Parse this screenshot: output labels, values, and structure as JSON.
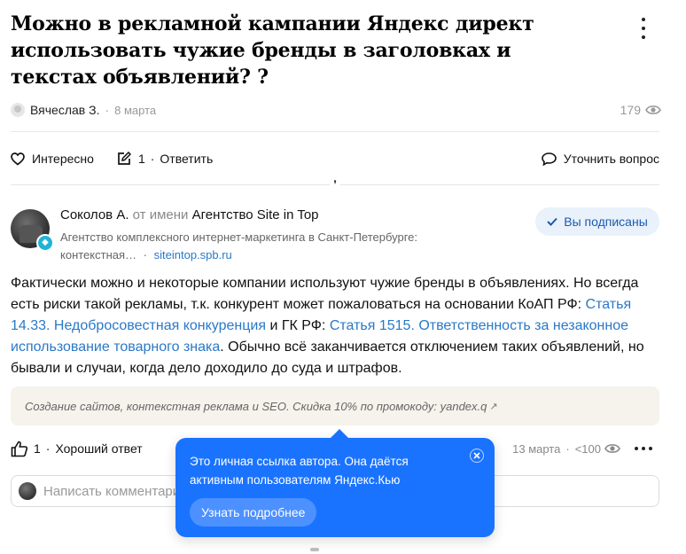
{
  "question": {
    "title": "Можно в рекламной кампании Яндекс директ использовать чужие бренды в заголовках и текстах объявлений? ?",
    "author": "Вячеслав З.",
    "date": "8 марта",
    "views": "179"
  },
  "actions": {
    "interesting": "Интересно",
    "answers_count": "1",
    "reply": "Ответить",
    "clarify": "Уточнить вопрос",
    "separator": "·"
  },
  "answer": {
    "author": "Соколов А.",
    "on_behalf": "от имени",
    "org": "Агентство Site in Top",
    "org_desc": "Агентство комплексного интернет-маркетинга в Санкт-Петербурге: контекстная…",
    "site": "siteintop.spb.ru",
    "subscribed": "Вы подписаны",
    "body": {
      "p1": "Фактически можно и некоторые компании используют чужие бренды в объявлениях. Но всегда есть риски такой рекламы, т.к. конкурент может пожаловаться на основании КоАП РФ: ",
      "link1": "Статья 14.33. Недобросовестная конкуренция",
      "p2": " и ГК РФ: ",
      "link2": "Статья 1515. Ответственность за незаконное использование товарного знака",
      "p3": ". Обычно всё заканчивается отключением таких объявлений, но бывали и случаи, когда дело доходило до суда и штрафов."
    },
    "promo": "Создание сайтов, контекстная реклама и SEO. Скидка 10% по промокоду: yandex.q",
    "likes": "1",
    "good_answer": "Хороший ответ",
    "date": "13 марта",
    "views": "<100"
  },
  "comment": {
    "placeholder": "Написать комментарий"
  },
  "tooltip": {
    "text": "Это личная ссылка автора. Она даётся активным пользователям Яндекс.Кью",
    "button": "Узнать подробнее"
  },
  "icons": [
    "kebab-icon",
    "eye-icon",
    "heart-icon",
    "edit-icon",
    "chat-icon",
    "check-icon",
    "thumb-up-icon",
    "close-icon",
    "external-arrow-icon"
  ],
  "colors": {
    "link": "#2979c8",
    "tooltip": "#1a73ff",
    "subscribed_bg": "#e9f1fb",
    "promo_bg": "#f6f2ec"
  }
}
